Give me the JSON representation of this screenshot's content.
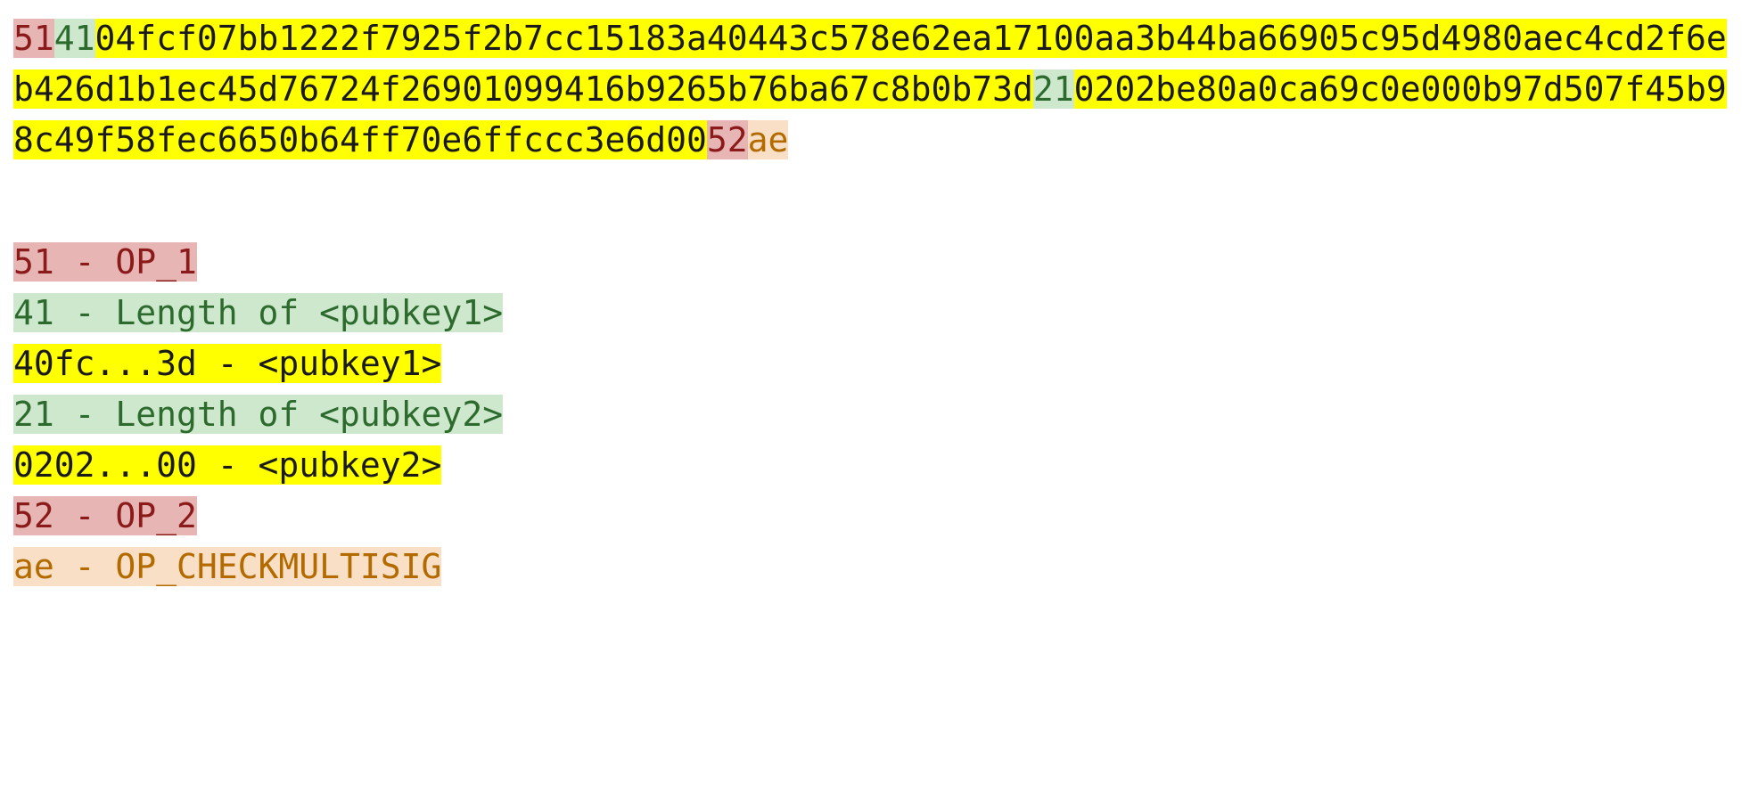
{
  "hex": {
    "s1": "51",
    "s2": "41",
    "s3": "04fcf07bb1222f7925f2b7cc15183a40443c578e62ea17100aa3b44ba66905c95d4980aec4cd2f6eb426d1b1ec45d76724f26901099416b9265b76ba67c8b0b73d",
    "s4": "21",
    "s5": "0202be80a0ca69c0e000b97d507f45b98c49f58fec6650b64ff70e6ffccc3e6d00",
    "s6": "52",
    "s7": "ae"
  },
  "legend": {
    "l1": "51 - OP_1",
    "l2": "41 - Length of <pubkey1>",
    "l3": "40fc...3d - <pubkey1>",
    "l4": "21 - Length of <pubkey2>",
    "l5": "0202...00 - <pubkey2>",
    "l6": "52 - OP_2",
    "l7": "ae - OP_CHECKMULTISIG"
  }
}
